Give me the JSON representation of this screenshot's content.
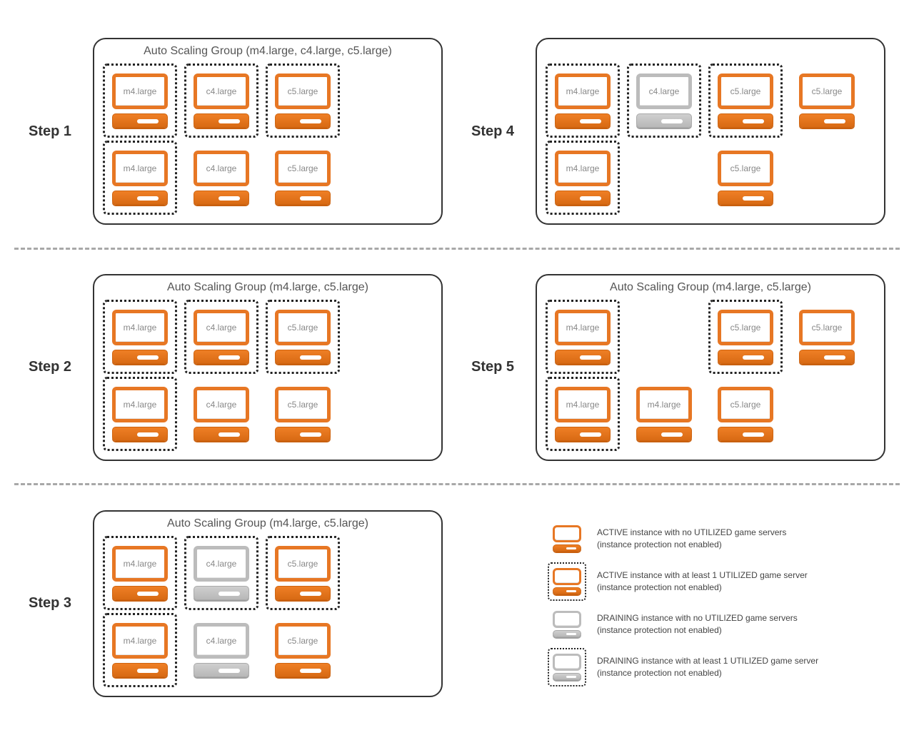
{
  "steps": [
    {
      "label": "Step 1",
      "title": "Auto Scaling Group (m4.large, c4.large, c5.large)",
      "instances": [
        {
          "text": "m4.large",
          "dashed": true,
          "gray": false
        },
        {
          "text": "c4.large",
          "dashed": true,
          "gray": false
        },
        {
          "text": "c5.large",
          "dashed": true,
          "gray": false
        },
        {
          "hidden": true
        },
        {
          "text": "m4.large",
          "dashed": true,
          "gray": false
        },
        {
          "text": "c4.large",
          "dashed": false,
          "gray": false
        },
        {
          "text": "c5.large",
          "dashed": false,
          "gray": false
        },
        {
          "hidden": true
        }
      ]
    },
    {
      "label": "Step 4",
      "title": "",
      "instances": [
        {
          "text": "m4.large",
          "dashed": true,
          "gray": false
        },
        {
          "text": "c4.large",
          "dashed": true,
          "gray": true
        },
        {
          "text": "c5.large",
          "dashed": true,
          "gray": false
        },
        {
          "text": "c5.large",
          "dashed": false,
          "gray": false
        },
        {
          "text": "m4.large",
          "dashed": true,
          "gray": false
        },
        {
          "hidden": true
        },
        {
          "text": "c5.large",
          "dashed": false,
          "gray": false
        },
        {
          "hidden": true
        }
      ]
    },
    {
      "label": "Step 2",
      "title": "Auto Scaling Group (m4.large, c5.large)",
      "instances": [
        {
          "text": "m4.large",
          "dashed": true,
          "gray": false
        },
        {
          "text": "c4.large",
          "dashed": true,
          "gray": false
        },
        {
          "text": "c5.large",
          "dashed": true,
          "gray": false
        },
        {
          "hidden": true
        },
        {
          "text": "m4.large",
          "dashed": true,
          "gray": false
        },
        {
          "text": "c4.large",
          "dashed": false,
          "gray": false
        },
        {
          "text": "c5.large",
          "dashed": false,
          "gray": false
        },
        {
          "hidden": true
        }
      ]
    },
    {
      "label": "Step 5",
      "title": "Auto Scaling Group (m4.large, c5.large)",
      "instances": [
        {
          "text": "m4.large",
          "dashed": true,
          "gray": false
        },
        {
          "hidden": true
        },
        {
          "text": "c5.large",
          "dashed": true,
          "gray": false
        },
        {
          "text": "c5.large",
          "dashed": false,
          "gray": false
        },
        {
          "text": "m4.large",
          "dashed": true,
          "gray": false
        },
        {
          "text": "m4.large",
          "dashed": false,
          "gray": false
        },
        {
          "text": "c5.large",
          "dashed": false,
          "gray": false
        },
        {
          "hidden": true
        }
      ]
    },
    {
      "label": "Step 3",
      "title": "Auto Scaling Group (m4.large, c5.large)",
      "instances": [
        {
          "text": "m4.large",
          "dashed": true,
          "gray": false
        },
        {
          "text": "c4.large",
          "dashed": true,
          "gray": true
        },
        {
          "text": "c5.large",
          "dashed": true,
          "gray": false
        },
        {
          "hidden": true
        },
        {
          "text": "m4.large",
          "dashed": true,
          "gray": false
        },
        {
          "text": "c4.large",
          "dashed": false,
          "gray": true
        },
        {
          "text": "c5.large",
          "dashed": false,
          "gray": false
        },
        {
          "hidden": true
        }
      ]
    }
  ],
  "legend": [
    {
      "dashed": false,
      "gray": false,
      "text": "ACTIVE instance with no UTILIZED game servers\n(instance protection not enabled)"
    },
    {
      "dashed": true,
      "gray": false,
      "text": "ACTIVE instance with at least 1 UTILIZED game server\n(instance protection not enabled)"
    },
    {
      "dashed": false,
      "gray": true,
      "text": "DRAINING instance with no UTILIZED game servers\n(instance protection not enabled)"
    },
    {
      "dashed": true,
      "gray": true,
      "text": "DRAINING instance with at least 1 UTILIZED game server\n(instance protection not enabled)"
    }
  ],
  "order": [
    0,
    1,
    2,
    3,
    4
  ]
}
